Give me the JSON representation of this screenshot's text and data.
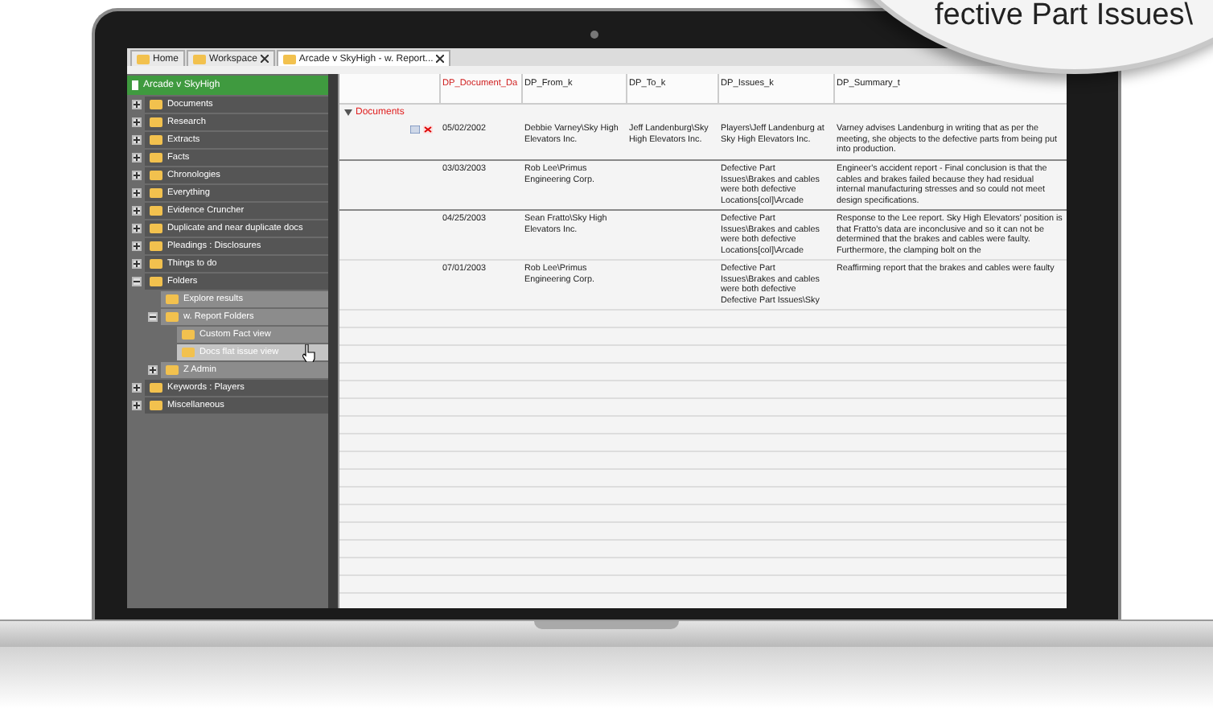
{
  "tabs": [
    {
      "label": "Home",
      "closable": false,
      "selected": false
    },
    {
      "label": "Workspace",
      "closable": true,
      "selected": false
    },
    {
      "label": "Arcade v SkyHigh - w. Report...",
      "closable": true,
      "selected": true
    }
  ],
  "tree": {
    "root": "Arcade v SkyHigh",
    "items": [
      {
        "label": "Documents",
        "expanded": false,
        "selected": false
      },
      {
        "label": "Research",
        "expanded": false,
        "selected": false
      },
      {
        "label": "Extracts",
        "expanded": false,
        "selected": false
      },
      {
        "label": "Facts",
        "expanded": false,
        "selected": false
      },
      {
        "label": "Chronologies",
        "expanded": false,
        "selected": false
      },
      {
        "label": "Everything",
        "expanded": false,
        "selected": false
      },
      {
        "label": "Evidence Cruncher",
        "expanded": false,
        "selected": false
      },
      {
        "label": "Duplicate and near duplicate docs",
        "expanded": false,
        "selected": false
      },
      {
        "label": "Pleadings : Disclosures",
        "expanded": false,
        "selected": false
      },
      {
        "label": "Things to do",
        "expanded": false,
        "selected": false
      },
      {
        "label": "Folders",
        "expanded": true,
        "selected": false,
        "children": [
          {
            "label": "Explore results",
            "selected": false
          },
          {
            "label": "w. Report Folders",
            "expanded": true,
            "selected": false,
            "children": [
              {
                "label": "Custom Fact view",
                "selected": false
              },
              {
                "label": "Docs flat issue view",
                "selected": true
              }
            ]
          },
          {
            "label": "Z Admin",
            "expanded": false,
            "selected": false
          }
        ]
      },
      {
        "label": "Keywords : Players",
        "expanded": false,
        "selected": false
      },
      {
        "label": "Miscellaneous",
        "expanded": false,
        "selected": false
      }
    ]
  },
  "grid": {
    "columns": [
      "DP_Document_Da",
      "DP_From_k",
      "DP_To_k",
      "DP_Issues_k",
      "DP_Summary_t"
    ],
    "group": "Documents",
    "group_expanded": true,
    "rows": [
      {
        "annotated": true,
        "cells": [
          "05/02/2002",
          "Debbie Varney\\Sky High Elevators Inc.",
          "Jeff Landenburg\\Sky High Elevators Inc.",
          "Players\\Jeff Landenburg at Sky High Elevators Inc.",
          "Varney advises Landenburg in writing that as per the meeting, she objects to the defective parts from being put into production."
        ]
      },
      {
        "annotated": false,
        "cells": [
          "03/03/2003",
          "Rob Lee\\Primus Engineering Corp.",
          null,
          "Defective Part Issues\\Brakes and cables were both defective Locations[col]\\Arcade",
          "Engineer's accident report - Final conclusion is that the cables and brakes failed because they had residual internal manufacturing stresses and so could not meet design specifications."
        ]
      },
      {
        "annotated": false,
        "cells": [
          "04/25/2003",
          "Sean Fratto\\Sky High Elevators Inc.",
          null,
          "Defective Part Issues\\Brakes and cables were both defective Locations[col]\\Arcade",
          "Response to the Lee report. Sky High Elevators' position is that Fratto's data are inconclusive and so it can not be determined that the brakes and cables were faulty. Furthermore, the clamping bolt on the"
        ]
      },
      {
        "annotated": false,
        "cells": [
          "07/01/2003",
          "Rob Lee\\Primus Engineering Corp.",
          null,
          "Defective Part Issues\\Brakes and cables were both defective Defective Part Issues\\Sky",
          "Reaffirming report that the brakes and cables were faulty"
        ]
      }
    ]
  },
  "magnifier": {
    "text": "fective Part Issues\\"
  }
}
